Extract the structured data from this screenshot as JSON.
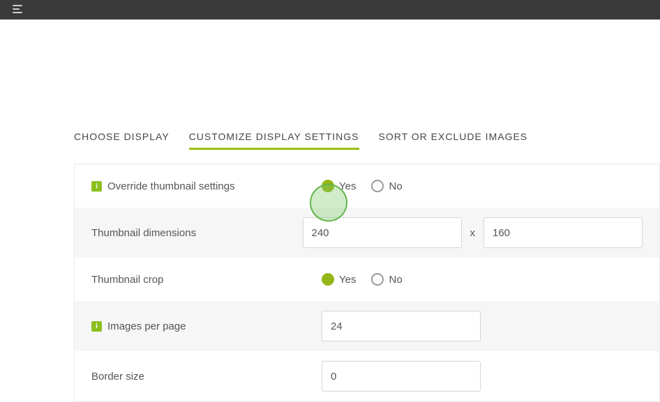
{
  "tabs": {
    "choose": "CHOOSE DISPLAY",
    "customize": "CUSTOMIZE DISPLAY SETTINGS",
    "sort": "SORT OR EXCLUDE IMAGES"
  },
  "labels": {
    "override": "Override thumbnail settings",
    "dimensions": "Thumbnail dimensions",
    "crop": "Thumbnail crop",
    "perpage": "Images per page",
    "bordersize": "Border size"
  },
  "options": {
    "yes": "Yes",
    "no": "No",
    "x": "x"
  },
  "values": {
    "dim_w": "240",
    "dim_h": "160",
    "perpage": "24",
    "bordersize": "0"
  },
  "info_glyph": "i"
}
